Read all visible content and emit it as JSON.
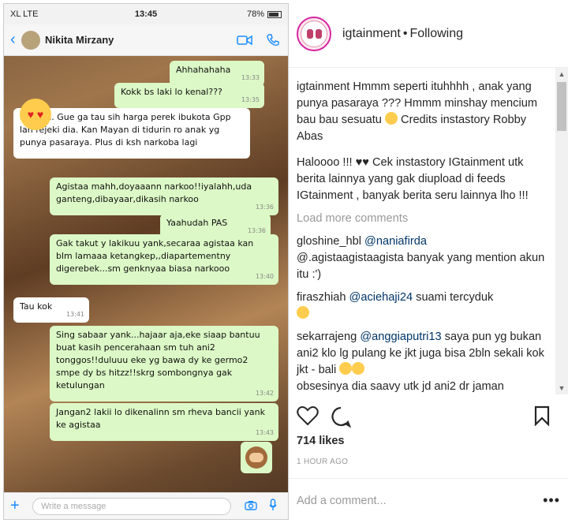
{
  "chat": {
    "status": {
      "carrier": "XL  LTE",
      "time": "13:45",
      "battery": "78%"
    },
    "contact_name": "Nikita Mirzany",
    "messages": [
      {
        "dir": "out",
        "text": "Ahhahahaha",
        "time": "13:33"
      },
      {
        "dir": "out",
        "text": "Kokk bs laki lo kenal???",
        "time": "13:35"
      },
      {
        "dir": "in",
        "text": "Iya yah. Gue ga tau sih harga perek ibukota Gpp lah rejeki dia. Kan Mayan di tidurin ro anak yg punya pasaraya. Plus di ksh narkoba lagi",
        "time": ""
      },
      {
        "dir": "out",
        "text": "Agistaa mahh,doyaaann narkoo!!iyalahh,uda ganteng,dibayaar,dikasih narkoo",
        "time": "13:36"
      },
      {
        "dir": "out",
        "text": "Yaahudah PAS",
        "time": "13:36"
      },
      {
        "dir": "out",
        "text": "Gak takut y lakikuu yank,secaraa agistaa kan blm lamaaa ketangkep,,diapartementny digerebek...sm genknyaa biasa narkooo",
        "time": "13:40"
      },
      {
        "dir": "in",
        "text": "Tau kok",
        "time": "13:41"
      },
      {
        "dir": "out",
        "text": "Sing sabaar yank...hajaar aja,eke siaap bantuu buat kasih pencerahaan sm tuh ani2 tonggos!!duluuu eke yg bawa dy ke germo2 smpe dy bs hitzz!!skrg sombongnya gak ketulungan",
        "time": "13:42"
      },
      {
        "dir": "out",
        "text": "Jangan2 lakii lo dikenalinn sm rheva bancii yank ke agistaa",
        "time": "13:43"
      }
    ],
    "sticker_time": "13:43",
    "input_placeholder": "Write a message"
  },
  "ig": {
    "username": "igtainment",
    "follow_state": "Following",
    "caption": {
      "user": "igtainment",
      "text": "Hmmm seperti ituhhhh , anak yang punya pasaraya ??? Hmmm minshay mencium bau bau sesuatu",
      "credits": "Credits instastory Robby Abas"
    },
    "caption2": "Haloooo !!! ♥♥ Cek instastory IGtainment utk berita lainnya yang gak diupload di feeds IGtainment , banyak berita seru lainnya lho !!!",
    "load_more": "Load more comments",
    "comments": [
      {
        "user": "gloshine_hbl",
        "mention": "@naniafirda",
        "text": "@.agistaagistaagista banyak yang mention akun itu :')"
      },
      {
        "user": "firaszhiah",
        "mention": "@aciehaji24",
        "text": "suami tercyduk"
      },
      {
        "user": "sekarrajeng",
        "mention": "@anggiaputri13",
        "text": "saya pun yg bukan ani2 klo lg pulang ke jkt juga bisa 2bln sekali kok jkt - bali"
      },
      {
        "user": "",
        "mention": "",
        "text": "obsesinya dia saavy utk jd ani2 dr jaman"
      }
    ],
    "likes": "714 likes",
    "time_ago": "1 HOUR AGO",
    "add_comment_placeholder": "Add a comment...",
    "more_label": "•••"
  }
}
